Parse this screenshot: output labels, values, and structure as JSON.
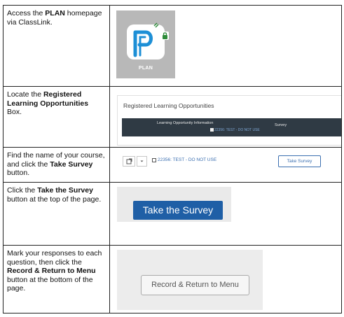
{
  "rows": [
    {
      "pre": "Access the ",
      "bold": "PLAN",
      "post": " homepage via ClassLink.",
      "tile_label": "PLAN"
    },
    {
      "pre": "Locate the ",
      "bold": "Registered Learning Opportunities",
      "post": " Box.",
      "box_title": "Registered Learning Opportunities",
      "col1": "Learning Opportunity Information",
      "col2": "Survey",
      "sub": "22356: TEST - DO NOT USE"
    },
    {
      "pre": "Find the name of your course, and click the ",
      "bold": "Take Survey",
      "post": " button.",
      "course": "22356: TEST - DO NOT USE",
      "button": "Take Survey"
    },
    {
      "pre": "Click the ",
      "bold": "Take the Survey",
      "post": " button at the top of the page.",
      "button": "Take the Survey"
    },
    {
      "pre": "Mark your responses to each question, then click the ",
      "bold": "Record & Return to Menu",
      "post": " button at the bottom of the page.",
      "button": "Record & Return to Menu"
    }
  ]
}
